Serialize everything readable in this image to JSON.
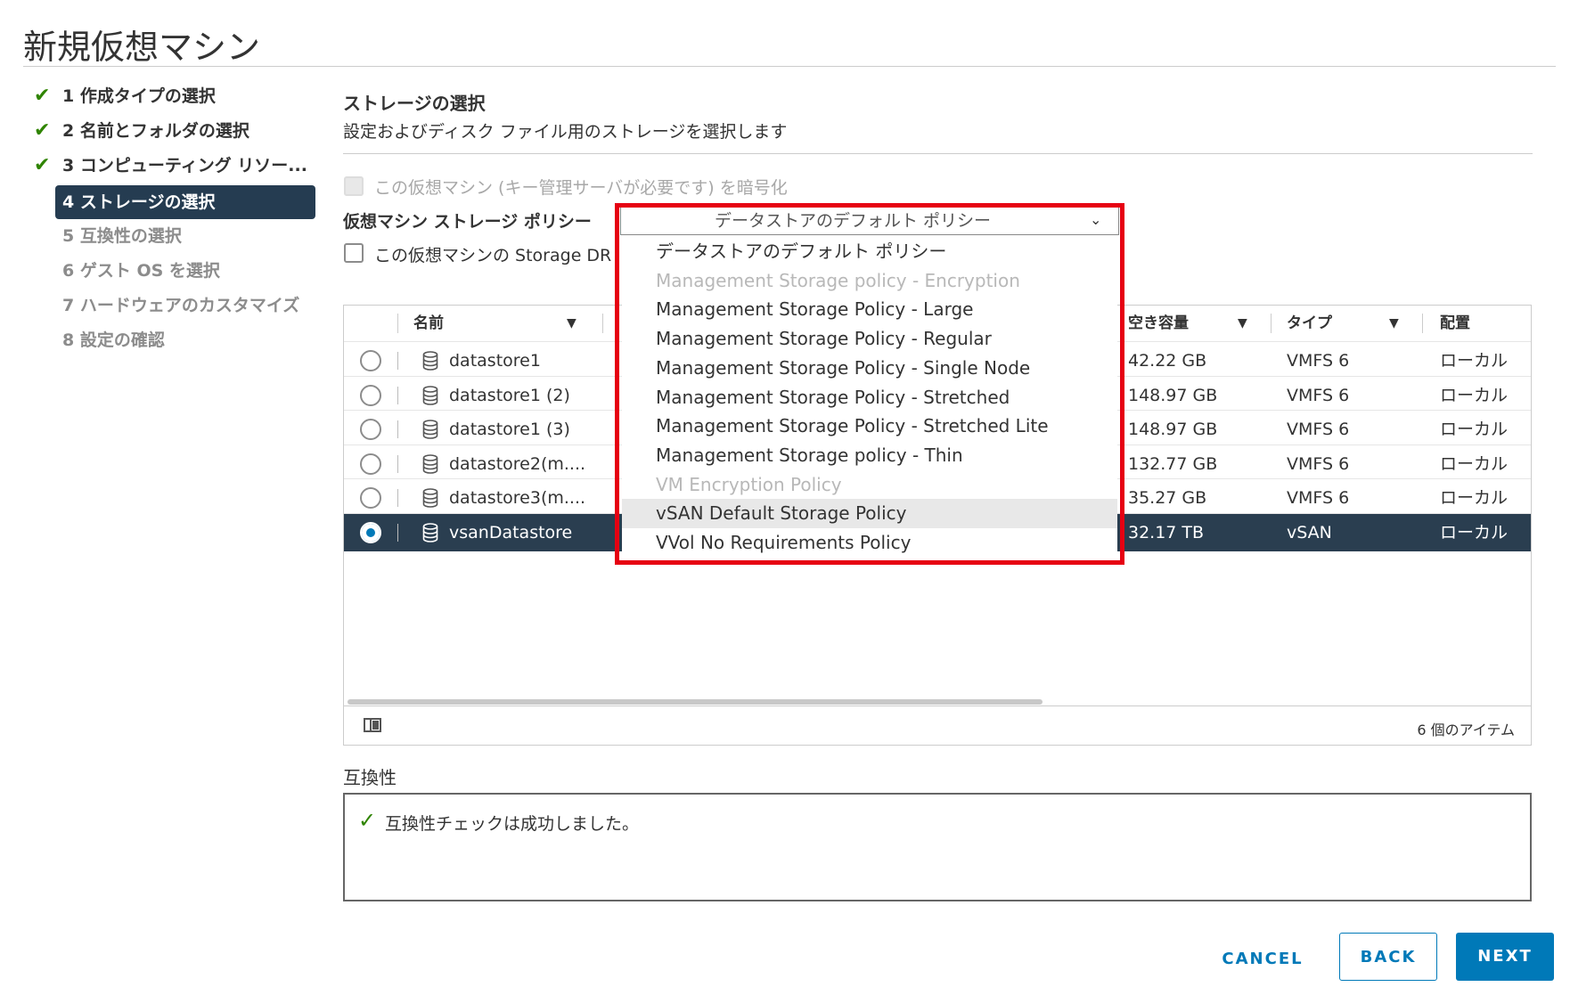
{
  "title": "新規仮想マシン",
  "steps": [
    {
      "label": "1 作成タイプの選択",
      "state": "done"
    },
    {
      "label": "2 名前とフォルダの選択",
      "state": "done"
    },
    {
      "label": "3 コンピューティング リソー...",
      "state": "done"
    },
    {
      "label": "4 ストレージの選択",
      "state": "active"
    },
    {
      "label": "5 互換性の選択",
      "state": "todo"
    },
    {
      "label": "6 ゲスト OS を選択",
      "state": "todo"
    },
    {
      "label": "7 ハードウェアのカスタマイズ",
      "state": "todo"
    },
    {
      "label": "8 設定の確認",
      "state": "todo"
    }
  ],
  "section": {
    "title": "ストレージの選択",
    "description": "設定およびディスク ファイル用のストレージを選択します"
  },
  "encrypt_label": "この仮想マシン (キー管理サーバが必要です) を暗号化",
  "policy_label": "仮想マシン ストレージ ポリシー",
  "drs_label": "この仮想マシンの Storage DR",
  "dropdown": {
    "selected": "データストアのデフォルト ポリシー",
    "options": [
      {
        "label": "データストアのデフォルト ポリシー",
        "disabled": false
      },
      {
        "label": "Management Storage policy - Encryption",
        "disabled": true
      },
      {
        "label": "Management Storage Policy - Large",
        "disabled": false
      },
      {
        "label": "Management Storage Policy - Regular",
        "disabled": false
      },
      {
        "label": "Management Storage Policy - Single Node",
        "disabled": false
      },
      {
        "label": "Management Storage Policy - Stretched",
        "disabled": false
      },
      {
        "label": "Management Storage Policy - Stretched Lite",
        "disabled": false
      },
      {
        "label": "Management Storage policy - Thin",
        "disabled": false
      },
      {
        "label": "VM Encryption Policy",
        "disabled": true
      },
      {
        "label": "vSAN Default Storage Policy",
        "disabled": false,
        "hover": true
      },
      {
        "label": "VVol No Requirements Policy",
        "disabled": false
      }
    ]
  },
  "grid": {
    "columns": {
      "name": "名前",
      "free": "空き容量",
      "type": "タイプ",
      "placement": "配置"
    },
    "rows": [
      {
        "name": "datastore1",
        "free": "42.22 GB",
        "type": "VMFS 6",
        "placement": "ローカル",
        "selected": false
      },
      {
        "name": "datastore1 (2)",
        "free": "148.97 GB",
        "type": "VMFS 6",
        "placement": "ローカル",
        "selected": false
      },
      {
        "name": "datastore1 (3)",
        "free": "148.97 GB",
        "type": "VMFS 6",
        "placement": "ローカル",
        "selected": false
      },
      {
        "name": "datastore2(m....",
        "free": "132.77 GB",
        "type": "VMFS 6",
        "placement": "ローカル",
        "selected": false
      },
      {
        "name": "datastore3(m....",
        "free": "35.27 GB",
        "type": "VMFS 6",
        "placement": "ローカル",
        "selected": false
      },
      {
        "name": "vsanDatastore",
        "free": "32.17 TB",
        "type": "vSAN",
        "placement": "ローカル",
        "selected": true
      }
    ],
    "item_count": "6 個のアイテム"
  },
  "compat": {
    "label": "互換性",
    "message": "互換性チェックは成功しました。"
  },
  "buttons": {
    "cancel": "CANCEL",
    "back": "BACK",
    "next": "NEXT"
  },
  "colors": {
    "accent": "#0079b8",
    "selected_row": "#2a3e50",
    "highlight": "#e60012",
    "success": "#2f8400"
  }
}
